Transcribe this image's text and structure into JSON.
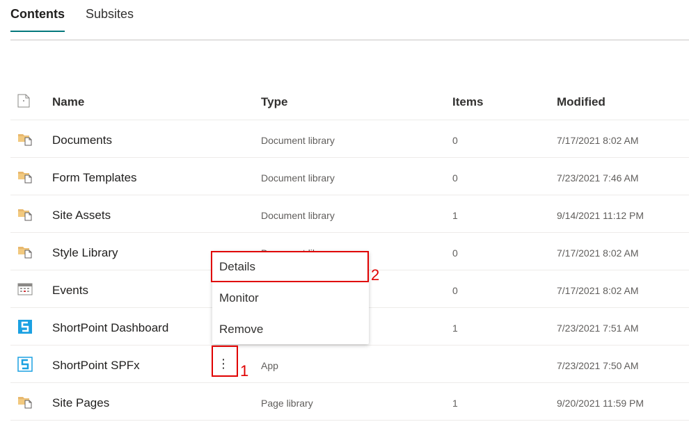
{
  "tabs": [
    {
      "label": "Contents",
      "active": true
    },
    {
      "label": "Subsites",
      "active": false
    }
  ],
  "table": {
    "headers": {
      "name": "Name",
      "type": "Type",
      "items": "Items",
      "modified": "Modified"
    },
    "rows": [
      {
        "icon": "folder-library-icon",
        "name": "Documents",
        "type": "Document library",
        "items": "0",
        "modified": "7/17/2021 8:02 AM"
      },
      {
        "icon": "folder-library-icon",
        "name": "Form Templates",
        "type": "Document library",
        "items": "0",
        "modified": "7/23/2021 7:46 AM"
      },
      {
        "icon": "folder-library-icon",
        "name": "Site Assets",
        "type": "Document library",
        "items": "1",
        "modified": "9/14/2021 11:12 PM"
      },
      {
        "icon": "folder-library-icon",
        "name": "Style Library",
        "type": "Document library",
        "items": "0",
        "modified": "7/17/2021 8:02 AM"
      },
      {
        "icon": "calendar-icon",
        "name": "Events",
        "type": "",
        "items": "0",
        "modified": "7/17/2021 8:02 AM"
      },
      {
        "icon": "shortpoint-app-icon",
        "name": "ShortPoint Dashboard",
        "type": "",
        "items": "1",
        "modified": "7/23/2021 7:51 AM"
      },
      {
        "icon": "shortpoint-app-icon",
        "name": "ShortPoint SPFx",
        "type": "App",
        "items": "",
        "modified": "7/23/2021 7:50 AM"
      },
      {
        "icon": "folder-library-icon",
        "name": "Site Pages",
        "type": "Page library",
        "items": "1",
        "modified": "9/20/2021 11:59 PM"
      }
    ]
  },
  "more_button": {
    "glyph": "⋮"
  },
  "context_menu": {
    "items": [
      {
        "label": "Details"
      },
      {
        "label": "Monitor"
      },
      {
        "label": "Remove"
      }
    ]
  },
  "annotations": {
    "one": "1",
    "two": "2",
    "color": "#e00000"
  },
  "colors": {
    "accent": "#03787c",
    "folder": "#e8b86d",
    "shortpoint": "#1ba1e2"
  }
}
